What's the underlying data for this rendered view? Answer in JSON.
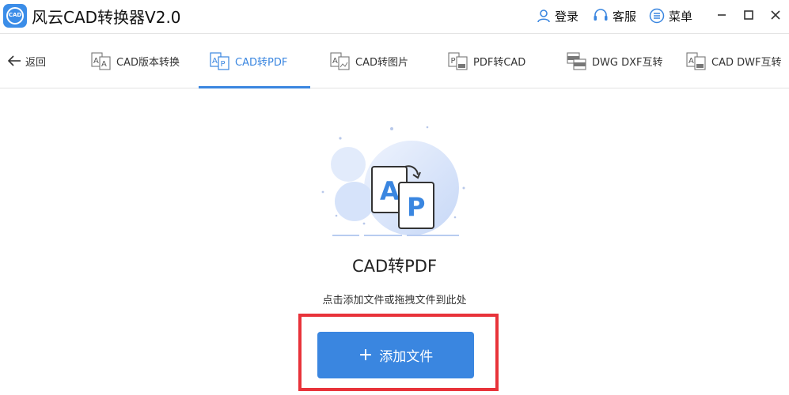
{
  "app": {
    "title": "风云CAD转换器V2.0",
    "logo_text": "CAD",
    "login_label": "登录",
    "service_label": "客服",
    "menu_label": "菜单"
  },
  "nav": {
    "back_label": "返回",
    "tabs": [
      {
        "label": "CAD版本转换",
        "icon": "cad-version-icon"
      },
      {
        "label": "CAD转PDF",
        "icon": "cad-to-pdf-icon",
        "active": true
      },
      {
        "label": "CAD转图片",
        "icon": "cad-to-image-icon"
      },
      {
        "label": "PDF转CAD",
        "icon": "pdf-to-cad-icon"
      },
      {
        "label": "DWG DXF互转",
        "icon": "dwg-dxf-icon"
      },
      {
        "label": "CAD DWF互转",
        "icon": "cad-dwf-icon"
      }
    ]
  },
  "main": {
    "title": "CAD转PDF",
    "hint": "点击添加文件或拖拽文件到此处",
    "add_button_label": "添加文件",
    "hero_letters": {
      "a": "A",
      "p": "P"
    }
  },
  "colors": {
    "accent": "#3a86e0",
    "highlight": "#e8333a"
  }
}
